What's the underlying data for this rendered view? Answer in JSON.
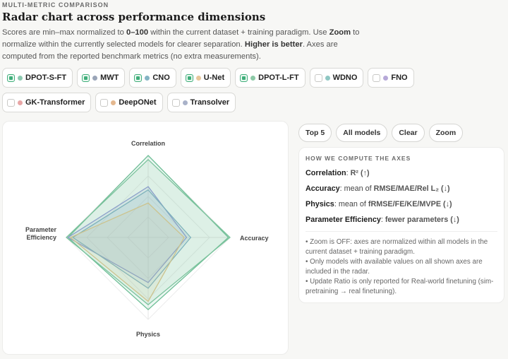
{
  "header": {
    "kicker": "MULTI-METRIC COMPARISON",
    "title": "Radar chart across performance dimensions",
    "desc": [
      {
        "t": "Scores are min–max normalized to "
      },
      {
        "t": "0–100",
        "b": true
      },
      {
        "t": " within the current dataset + training paradigm. Use "
      },
      {
        "t": "Zoom",
        "b": true
      },
      {
        "t": " to normalize within the currently selected models for clearer separation. "
      },
      {
        "t": "Higher is better",
        "b": true
      },
      {
        "t": ". Axes are computed from the reported benchmark metrics (no extra measurements)."
      }
    ]
  },
  "models": [
    {
      "id": "dpot-s-ft",
      "label": "DPOT-S-FT",
      "checked": true,
      "color": "#8cc9b0"
    },
    {
      "id": "mwt",
      "label": "MWT",
      "checked": true,
      "color": "#9aa5b8"
    },
    {
      "id": "cno",
      "label": "CNO",
      "checked": true,
      "color": "#84b4c4"
    },
    {
      "id": "u-net",
      "label": "U-Net",
      "checked": true,
      "color": "#e8c79a"
    },
    {
      "id": "dpot-l-ft",
      "label": "DPOT-L-FT",
      "checked": true,
      "color": "#8cc9a6"
    },
    {
      "id": "wdno",
      "label": "WDNO",
      "checked": false,
      "color": "#8fc7c3"
    },
    {
      "id": "fno",
      "label": "FNO",
      "checked": false,
      "color": "#b6a8d8"
    },
    {
      "id": "gk-transformer",
      "label": "GK-Transformer",
      "checked": false,
      "color": "#e8a6a6"
    },
    {
      "id": "deeponet",
      "label": "DeepONet",
      "checked": false,
      "color": "#e4b88f"
    },
    {
      "id": "transolver",
      "label": "Transolver",
      "checked": false,
      "color": "#a9b2c9"
    }
  ],
  "controls": {
    "top5": "Top 5",
    "all": "All models",
    "clear": "Clear",
    "zoom": "Zoom"
  },
  "info": {
    "heading": "HOW WE COMPUTE THE AXES",
    "defs": [
      {
        "term": "Correlation",
        "sep": ": ",
        "val": "R² (↑)"
      },
      {
        "term": "Accuracy",
        "sep": ": mean of ",
        "val": "RMSE/MAE/Rel L₂ (↓)"
      },
      {
        "term": "Physics",
        "sep": ": mean of ",
        "val": "fRMSE/FE/KE/MVPE (↓)"
      },
      {
        "term": "Parameter Efficiency",
        "sep": ": ",
        "val": "fewer parameters (↓)"
      }
    ],
    "notes": [
      "• Zoom is OFF: axes are normalized within all models in the current dataset + training paradigm.",
      "• Only models with available values on all shown axes are included in the radar.",
      "• Update Ratio is only reported for Real-world finetuning (sim-pretraining → real finetuning)."
    ]
  },
  "chart_data": {
    "type": "radar",
    "axes": [
      "Correlation",
      "Accuracy",
      "Physics",
      "Parameter Efficiency"
    ],
    "axis_label_lines": [
      [
        "Correlation"
      ],
      [
        "Accuracy"
      ],
      [
        "Physics"
      ],
      [
        "Parameter",
        "Efficiency"
      ]
    ],
    "range": [
      0,
      100
    ],
    "series": [
      {
        "model": "dpot-s-ft",
        "color": "#6fbf97",
        "values": [
          100,
          98,
          88,
          98
        ]
      },
      {
        "model": "mwt",
        "color": "#8e9bd0",
        "values": [
          62,
          47,
          55,
          98
        ]
      },
      {
        "model": "cno",
        "color": "#7fb0c0",
        "values": [
          58,
          52,
          62,
          92
        ]
      },
      {
        "model": "u-net",
        "color": "#d8c48c",
        "values": [
          42,
          44,
          78,
          95
        ]
      },
      {
        "model": "dpot-l-ft",
        "color": "#7cc39d",
        "values": [
          95,
          100,
          82,
          100
        ]
      }
    ]
  }
}
